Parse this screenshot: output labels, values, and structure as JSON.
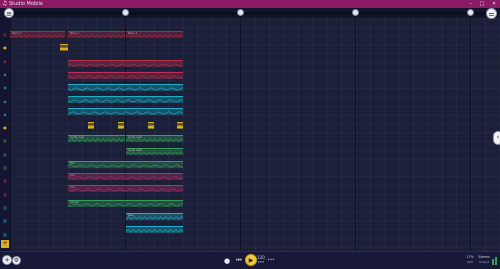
{
  "app": {
    "title": "Studio Mobile"
  },
  "window": {
    "minimize": "–",
    "maximize": "□",
    "close": "✕"
  },
  "colors": {
    "titlebar": "#8a1a63",
    "background": "#1c1f38",
    "red": "#b8233c",
    "teal": "#19b2c6",
    "green": "#2fa454",
    "magenta": "#bb2c6a",
    "yellow": "#d7b11d"
  },
  "tracks": [
    {
      "icon": "keyboard-icon",
      "color": "#b8233c",
      "glyph": "▥"
    },
    {
      "icon": "mic-icon",
      "color": "#d7b11d",
      "glyph": "●"
    },
    {
      "icon": "drum-icon",
      "color": "#c0304e",
      "glyph": "◈"
    },
    {
      "icon": "drum-icon",
      "color": "#19b2c6",
      "glyph": "◈"
    },
    {
      "icon": "drum-icon",
      "color": "#19b2c6",
      "glyph": "◈"
    },
    {
      "icon": "drum-icon",
      "color": "#19b2c6",
      "glyph": "◈"
    },
    {
      "icon": "drum-icon",
      "color": "#19b2c6",
      "glyph": "◈"
    },
    {
      "icon": "mic-icon",
      "color": "#d7b11d",
      "glyph": "●"
    },
    {
      "icon": "keyboard-icon",
      "color": "#2fa454",
      "glyph": "▥"
    },
    {
      "icon": "keyboard-icon",
      "color": "#2fa454",
      "glyph": "▥"
    },
    {
      "icon": "keyboard-icon",
      "color": "#2fa454",
      "glyph": "▥"
    },
    {
      "icon": "keyboard-icon",
      "color": "#bb2c6a",
      "glyph": "▥"
    },
    {
      "icon": "keyboard-icon",
      "color": "#bb2c6a",
      "glyph": "▥"
    },
    {
      "icon": "keyboard-icon",
      "color": "#2fa454",
      "glyph": "▥"
    },
    {
      "icon": "keyboard-icon",
      "color": "#19b2c6",
      "glyph": "▥"
    },
    {
      "icon": "keyboard-icon",
      "color": "#19b2c6",
      "glyph": "▥"
    }
  ],
  "clips": [
    {
      "label": "Piano 1",
      "color": "#b8233c"
    },
    {
      "label": "Piano 1",
      "color": "#b8233c"
    },
    {
      "label": "Piano 1",
      "color": "#b8233c"
    },
    {
      "label": "",
      "color": "#d7b11d"
    },
    {
      "label": "",
      "color": "#c0304e"
    },
    {
      "label": "",
      "color": "#c0304e"
    },
    {
      "label": "",
      "color": "#19b2c6"
    },
    {
      "label": "",
      "color": "#19b2c6"
    },
    {
      "label": "",
      "color": "#19b2c6"
    },
    {
      "label": "",
      "color": "#d7b11d"
    },
    {
      "label": "",
      "color": "#d7b11d"
    },
    {
      "label": "",
      "color": "#d7b11d"
    },
    {
      "label": "",
      "color": "#d7b11d"
    },
    {
      "label": "Synth Lead",
      "color": "#2fa454"
    },
    {
      "label": "Synth Lead",
      "color": "#2fa454"
    },
    {
      "label": "Synth Lead",
      "color": "#2fa454"
    },
    {
      "label": "Pad",
      "color": "#2fa454"
    },
    {
      "label": "Arp",
      "color": "#bb2c6a"
    },
    {
      "label": "Arp",
      "color": "#bb2c6a"
    },
    {
      "label": "Chords",
      "color": "#2fa454"
    },
    {
      "label": "Bass",
      "color": "#19b2c6"
    },
    {
      "label": "",
      "color": "#19b2c6"
    }
  ],
  "transport": {
    "record": "●",
    "rewind": "⏮",
    "play": "▶",
    "tempo_value": "120",
    "tempo_unit": "BPM",
    "more": "•••",
    "meter_value": "17%",
    "meter_label": "CPU",
    "mode_value": "Stereo",
    "mode_label": "Output"
  },
  "left_buttons": {
    "track_menu": "≡",
    "add_track": "+",
    "add_track_bottom": "+"
  },
  "right_buttons": {
    "toggle_panel": "⚌",
    "inspector": "‹",
    "settings": "⚙"
  }
}
